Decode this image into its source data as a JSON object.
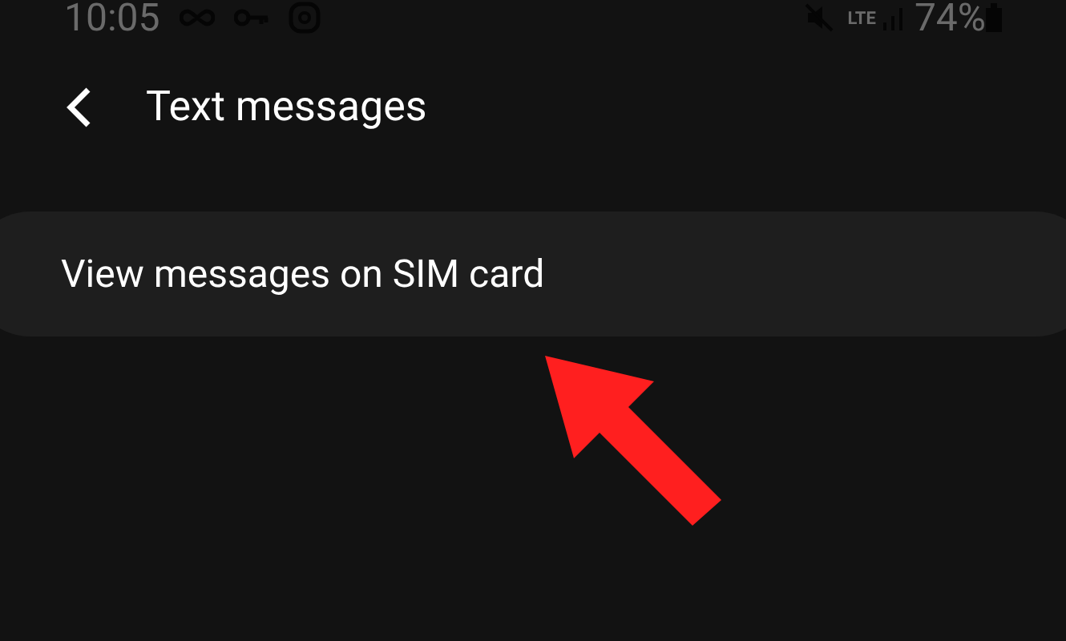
{
  "status_bar": {
    "time": "10:05",
    "battery": "74%",
    "lte": "LTE"
  },
  "header": {
    "title": "Text messages"
  },
  "items": [
    {
      "label": "View messages on SIM card"
    }
  ]
}
